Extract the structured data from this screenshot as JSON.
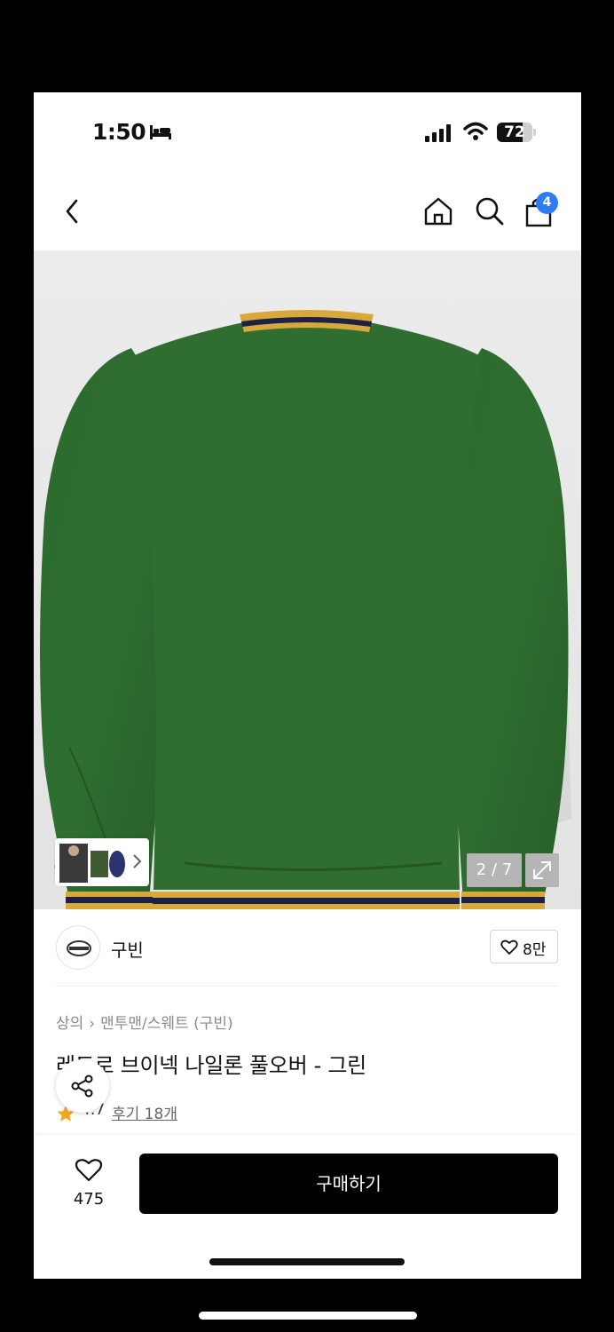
{
  "status_bar": {
    "time": "1:50",
    "battery": "72",
    "battery_level": 0.72
  },
  "nav": {
    "cart_count": "4"
  },
  "gallery": {
    "page_counter": "2 / 7"
  },
  "brand": {
    "name": "구빈",
    "like_count": "8만"
  },
  "product": {
    "breadcrumb": [
      "상의",
      "맨투맨/스웨트 (구빈)"
    ],
    "title": "레트로 브이넥 나일론 풀오버 - 그린",
    "rating": "4.7",
    "review_label": "후기 18개"
  },
  "bottom_bar": {
    "wish_count": "475",
    "buy_label": "구매하기"
  },
  "colors": {
    "accent": "#2f7bf6",
    "jacket_green": "#2f6b2f",
    "rib_gold": "#d9a83a",
    "rib_navy": "#1d2147",
    "star": "#f5a623"
  },
  "icons": [
    "bed-icon",
    "signal-icon",
    "wifi-icon",
    "back-icon",
    "home-icon",
    "search-icon",
    "cart-icon",
    "expand-icon",
    "heart-icon",
    "share-icon",
    "star-icon"
  ]
}
